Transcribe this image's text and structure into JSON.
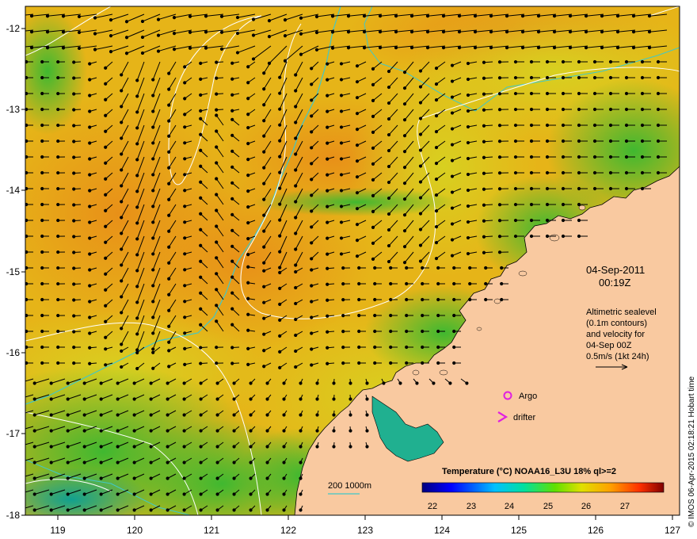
{
  "map": {
    "x_ticks": [
      "119",
      "120",
      "121",
      "122",
      "123",
      "124",
      "125",
      "126",
      "127"
    ],
    "y_ticks": [
      "-12",
      "-13",
      "-14",
      "-15",
      "-16",
      "-17",
      "-18"
    ],
    "date_line1": "04-Sep-2011",
    "date_line2": "00:19Z",
    "info_lines": [
      "Altimetric sealevel",
      "(0.1m contours)",
      "and velocity for",
      "04-Sep 00Z",
      "0.5m/s (1kt 24h)"
    ],
    "legend_argo": "Argo",
    "legend_drifter": "drifter",
    "bathymetry_label": "200  1000m",
    "side_credit": "© IMOS 06-Apr-2015 02:18:21 Hobart time",
    "colorbar": {
      "title": "Temperature (°C) NOAA16_L3U 18% ql>=2",
      "ticks": [
        "22",
        "23",
        "24",
        "25",
        "26",
        "27"
      ]
    },
    "colors": {
      "land": "#f9c9a0",
      "warm": "#f0a020",
      "mid": "#e8d020",
      "cool": "#60c030",
      "cold": "#10a0a0",
      "contour": "#ffffff",
      "bathymetry": "#40c8c8",
      "argo": "#e020e0"
    }
  }
}
